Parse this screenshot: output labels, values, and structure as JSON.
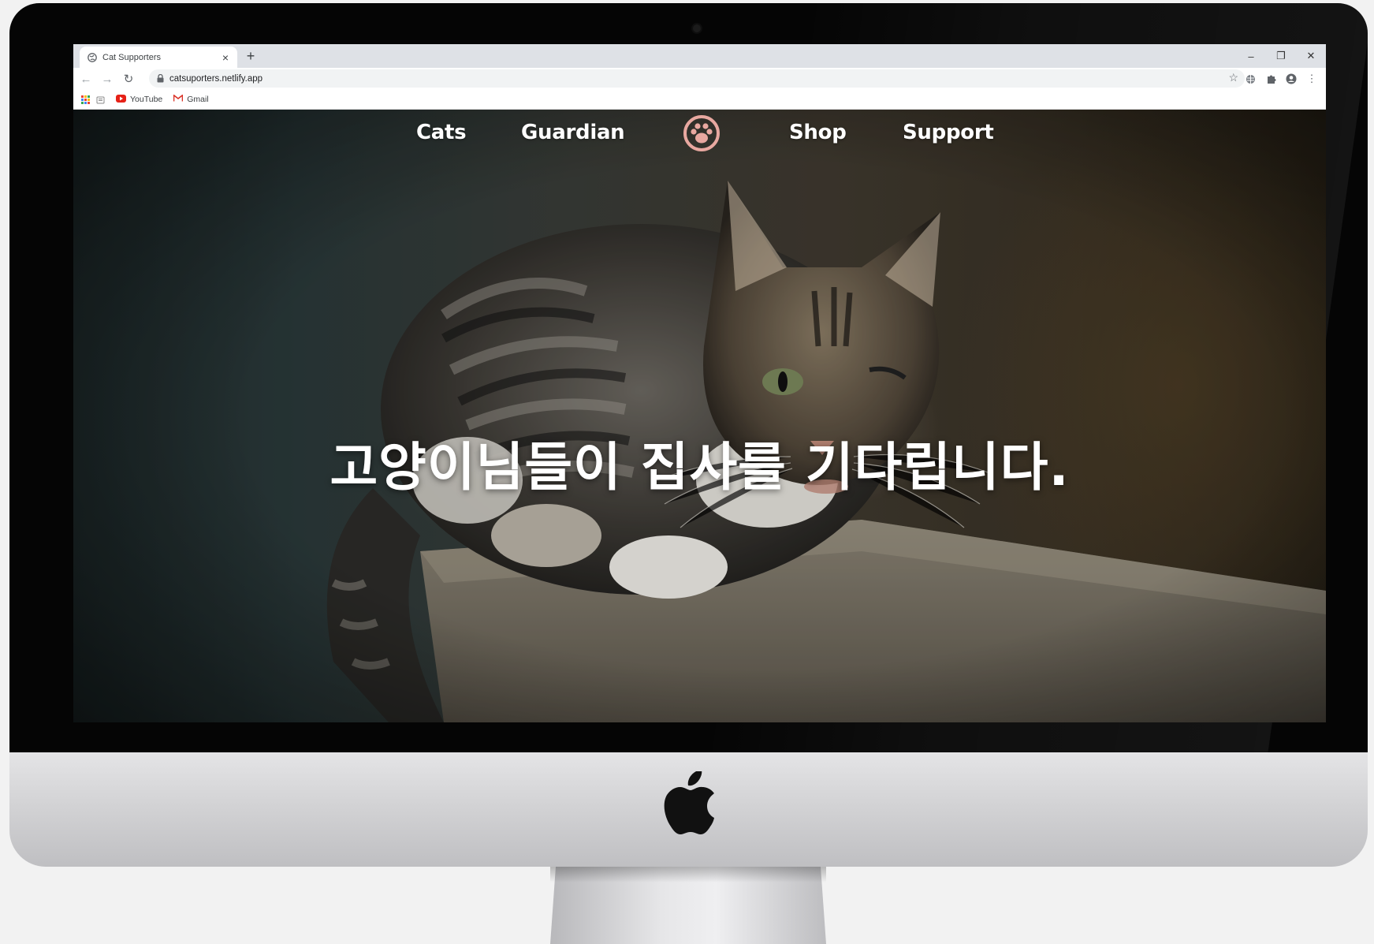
{
  "browser": {
    "tab_title": "Cat Supporters",
    "tab_close": "×",
    "new_tab": "+",
    "url": "catsuporters.netlify.app",
    "bookmarks": [
      {
        "label": "YouTube",
        "icon": "youtube-icon"
      },
      {
        "label": "Gmail",
        "icon": "gmail-icon"
      }
    ],
    "window_controls": {
      "minimize": "–",
      "restore": "❐",
      "close": "✕"
    }
  },
  "site": {
    "nav": {
      "cats": "Cats",
      "guardian": "Guardian",
      "shop": "Shop",
      "support": "Support",
      "logo_icon": "paw-icon"
    },
    "hero_heading": "고양이님들이 집사를 기다립니다."
  },
  "colors": {
    "logo_accent": "#e8a8a0",
    "nav_text": "#ffffff",
    "hero_text": "#ffffff"
  }
}
